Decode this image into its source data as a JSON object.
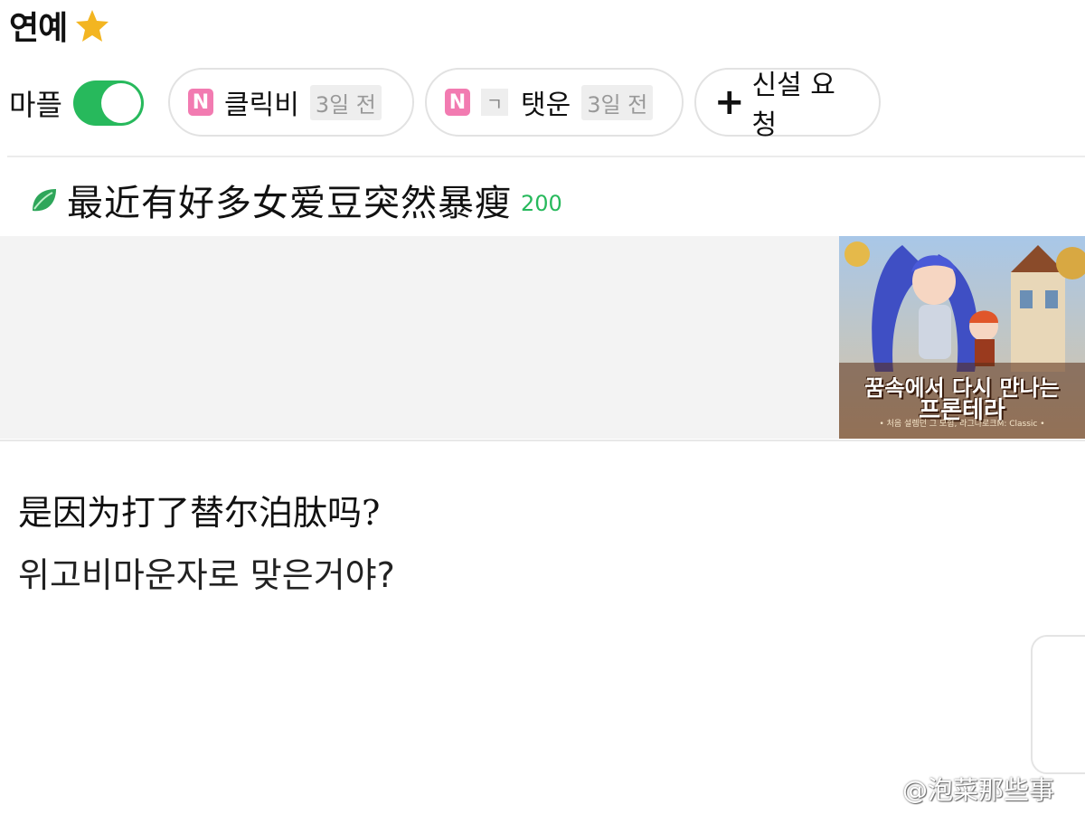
{
  "header": {
    "category": "연예",
    "star_icon": "star-icon"
  },
  "toolbar": {
    "mafeul_label": "마플",
    "toggle_on": true,
    "chips": [
      {
        "badge": "N",
        "label": "클릭비",
        "time": "3일 전"
      },
      {
        "badge": "N",
        "sub_badge": "ㄱ",
        "label": "탯운",
        "time": "3일 전"
      }
    ],
    "new_request": {
      "plus": "+",
      "label": "신설 요청"
    }
  },
  "post": {
    "title": "最近有好多女爱豆突然暴瘦",
    "count": "200",
    "leaf_icon": "leaf-icon",
    "body_line1": "是因为打了替尔泊肽吗?",
    "body_line2": "위고비마운자로 맞은거야?"
  },
  "ad": {
    "line1": "꿈속에서 다시 만나는",
    "line2": "프론테라",
    "line3": "• 처음 설렘던 그 모험, 라그나로크M: Classic •"
  },
  "watermark": {
    "text": "@泡菜那些事"
  },
  "colors": {
    "accent_green": "#27b95c",
    "badge_pink": "#f27bb1"
  }
}
